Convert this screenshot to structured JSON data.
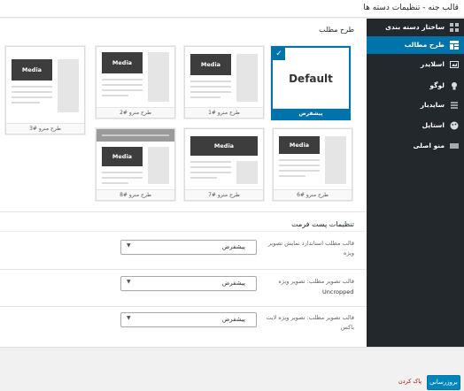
{
  "header": {
    "title": "قالب جنه - تنظیمات دسته ها"
  },
  "sidebar": {
    "items": [
      {
        "label": "ساختار دسته بندی",
        "icon": "grid-icon",
        "active": false
      },
      {
        "label": "طرح مطالب",
        "icon": "layout-icon",
        "active": true
      },
      {
        "label": "اسلایدر",
        "icon": "slider-icon",
        "active": false
      },
      {
        "label": "لوگو",
        "icon": "lightbulb-icon",
        "active": false
      },
      {
        "label": "سایدبار",
        "icon": "sidebar-icon",
        "active": false
      },
      {
        "label": "استایل",
        "icon": "palette-icon",
        "active": false
      },
      {
        "label": "منو اصلی",
        "icon": "menu-icon",
        "active": false
      }
    ]
  },
  "layouts_section": {
    "title": "طرح مطلب",
    "default_thumb_text": "Default",
    "media_label": "Media",
    "cards": [
      {
        "caption": "پیشفرض",
        "selected": true
      },
      {
        "caption": "طرح منرو #1",
        "selected": false
      },
      {
        "caption": "طرح منرو #2",
        "selected": false
      },
      {
        "caption": "طرح منرو #3",
        "selected": false
      },
      {
        "caption": "طرح منرو #6",
        "selected": false
      },
      {
        "caption": "طرح منرو #7",
        "selected": false
      },
      {
        "caption": "طرح منرو #8",
        "selected": false
      }
    ]
  },
  "post_format_section": {
    "title": "تنظیمات پست فرمت",
    "rows": [
      {
        "label": "قالب مطلب استاندارد نمایش تصویر ویژه",
        "value": "پیشفرض",
        "sub": ""
      },
      {
        "label": "قالب تصویر مطلب: تصویر ویژه",
        "value": "پیشفرض",
        "sub": "Uncropped"
      },
      {
        "label": "قالب تصویر مطلب: تصویر ویژه لایت باکس",
        "value": "پیشفرض",
        "sub": ""
      }
    ]
  },
  "footer": {
    "save_label": "بروزرسانی",
    "reset_label": "پاک کردن"
  },
  "colors": {
    "accent": "#0073aa",
    "sidebar_bg": "#23282d",
    "media_bg": "#3d3d3d"
  }
}
